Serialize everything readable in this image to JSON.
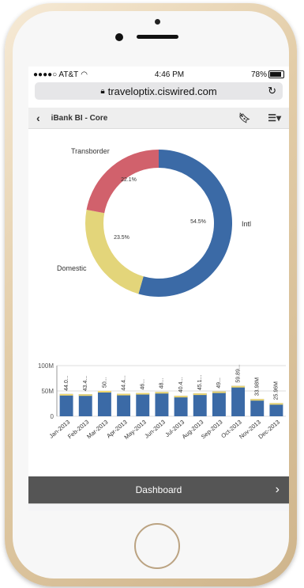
{
  "status": {
    "carrier": "●●●●○ AT&T",
    "time": "4:46 PM",
    "battery": "78%"
  },
  "browser": {
    "url": "traveloptix.ciswired.com",
    "lock_icon": "lock-icon",
    "reload_icon": "reload-icon"
  },
  "app": {
    "title": "iBank BI - Core",
    "back_icon": "chevron-left-icon",
    "bookmark_icon": "bookmark-icon",
    "menu_icon": "list-menu-icon"
  },
  "donut": {
    "type": "pie",
    "slices": [
      {
        "label": "Intl",
        "value": 54.5,
        "pct_label": "54.5%",
        "color": "#3b6aa6"
      },
      {
        "label": "Domestic",
        "value": 23.5,
        "pct_label": "23.5%",
        "color": "#e3d57a"
      },
      {
        "label": "Transborder",
        "value": 22.1,
        "pct_label": "22.1%",
        "color": "#d1616c"
      }
    ]
  },
  "chart_data": {
    "type": "bar",
    "categories": [
      "Jan-2013",
      "Feb-2013",
      "Mar-2013",
      "Apr-2013",
      "May-2013",
      "Jun-2013",
      "Jul-2013",
      "Aug-2013",
      "Sep-2013",
      "Oct-2013",
      "Nov-2013",
      "Dec-2013"
    ],
    "values": [
      44,
      43.4,
      50,
      44.4,
      46,
      48,
      40.4,
      45.1,
      49,
      59.89,
      33.98,
      25.96
    ],
    "labels": [
      "44.0...",
      "43.4...",
      "50...",
      "44.4...",
      "46...",
      "48...",
      "40.4...",
      "45.1...",
      "49...",
      "59.89...",
      "33.98M",
      "25.96M"
    ],
    "yticks": [
      "100M",
      "50M",
      "0"
    ],
    "ylim": [
      0,
      100
    ],
    "bar_color": "#3b6aa6"
  },
  "dashboard": {
    "label": "Dashboard"
  },
  "toolbar": {
    "back": "‹",
    "forward": "›",
    "share": "⇪",
    "bookmarks": "📖",
    "tabs": "❐"
  }
}
